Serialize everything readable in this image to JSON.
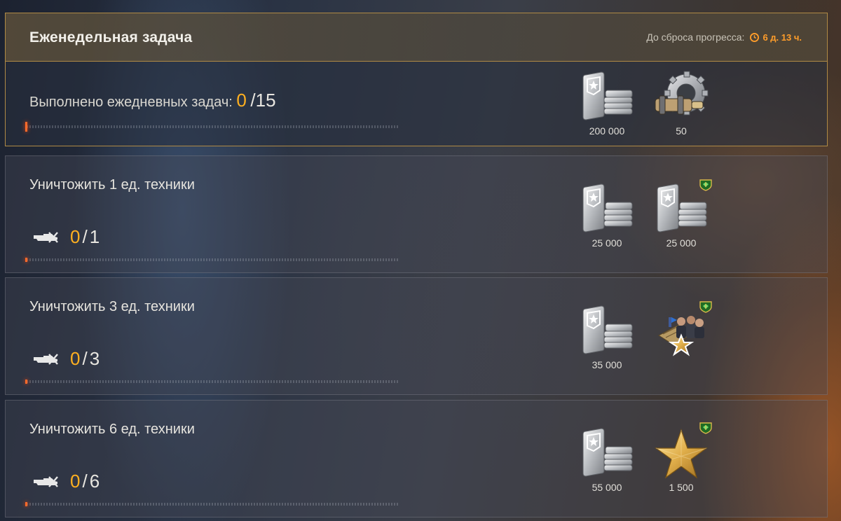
{
  "weekly": {
    "title": "Еженедельная задача",
    "reset_label": "До сброса прогресса:",
    "reset_time": "6 д. 13 ч.",
    "progress_label": "Выполнено ежедневных задач:",
    "progress_current": "0",
    "progress_separator": "/",
    "progress_total": "15",
    "rewards": [
      {
        "icon": "silver-icon",
        "amount": "200 000"
      },
      {
        "icon": "equipment-gear-icon",
        "amount": "50"
      }
    ]
  },
  "tasks": [
    {
      "title": "Уничтожить 1 ед. техники",
      "current": "0",
      "separator": "/",
      "total": "1",
      "rewards": [
        {
          "icon": "silver-icon",
          "amount": "25 000"
        },
        {
          "icon": "silver-icon",
          "amount": "25 000",
          "premium": true
        }
      ]
    },
    {
      "title": "Уничтожить 3 ед. техники",
      "current": "0",
      "separator": "/",
      "total": "3",
      "rewards": [
        {
          "icon": "silver-icon",
          "amount": "35 000"
        },
        {
          "icon": "crew-training-icon",
          "amount": "",
          "premium": true
        }
      ]
    },
    {
      "title": "Уничтожить 6 ед. техники",
      "current": "0",
      "separator": "/",
      "total": "6",
      "rewards": [
        {
          "icon": "silver-icon",
          "amount": "55 000"
        },
        {
          "icon": "experience-star-icon",
          "amount": "1 500",
          "premium": true
        }
      ]
    }
  ],
  "colors": {
    "accent_orange": "#ffb020",
    "gold_border": "#b08a45",
    "timer_orange": "#ff9d2a",
    "premium_green": "#2fa53a"
  }
}
